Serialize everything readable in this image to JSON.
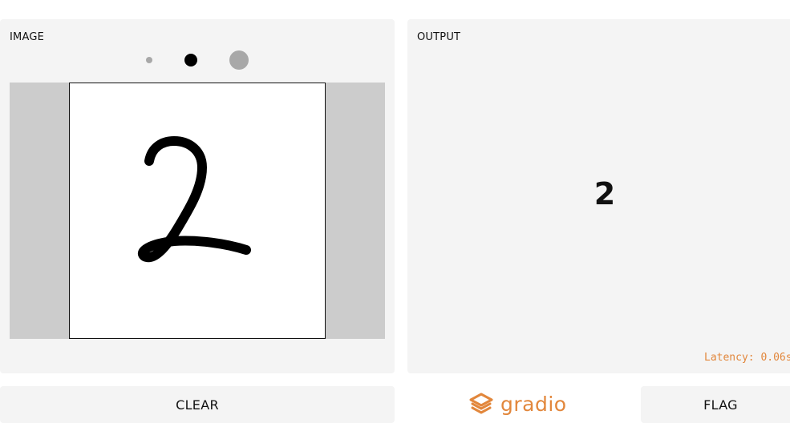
{
  "input_panel": {
    "label": "IMAGE",
    "brush_sizes": [
      "small",
      "medium",
      "large"
    ],
    "selected_brush": "medium",
    "drawn_content": "2"
  },
  "output_panel": {
    "label": "OUTPUT",
    "value": "2",
    "latency": "Latency: 0.06s"
  },
  "actions": {
    "clear_label": "CLEAR",
    "flag_label": "FLAG"
  },
  "branding": {
    "name": "gradio",
    "icon": "gradio-logo-icon",
    "color": "#e2873c"
  },
  "colors": {
    "panel_bg": "#f4f4f4",
    "canvas_backdrop": "#cccccc",
    "accent": "#e2873c",
    "stroke": "#000000"
  }
}
